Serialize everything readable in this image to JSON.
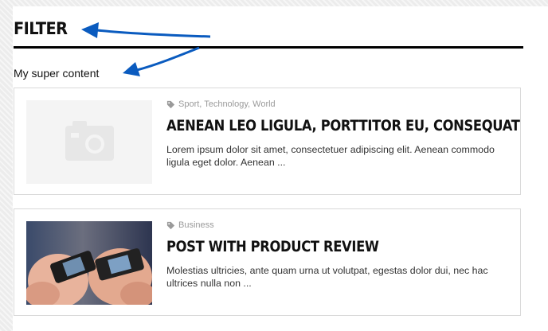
{
  "widget": {
    "title": "FILTER",
    "subtitle": "My super content"
  },
  "posts": [
    {
      "tags": "Sport, Technology, World",
      "title": "AENEAN LEO LIGULA, PORTTITOR EU, CONSEQUAT",
      "excerpt": "Lorem ipsum dolor sit amet, consectetuer adipiscing elit. Aenean commodo ligula eget dolor. Aenean ...",
      "thumbnail": "placeholder-camera-icon"
    },
    {
      "tags": "Business",
      "title": "POST WITH PRODUCT REVIEW",
      "excerpt": "Molestias ultricies, ante quam urna ut volutpat, egestas dolor dui, nec hac ultrices nulla non ...",
      "thumbnail": "hands-holding-phones-photo"
    }
  ],
  "colors": {
    "accent_arrow": "#0a5bbf",
    "title_rule": "#000000",
    "meta_text": "#9a9a9a"
  }
}
